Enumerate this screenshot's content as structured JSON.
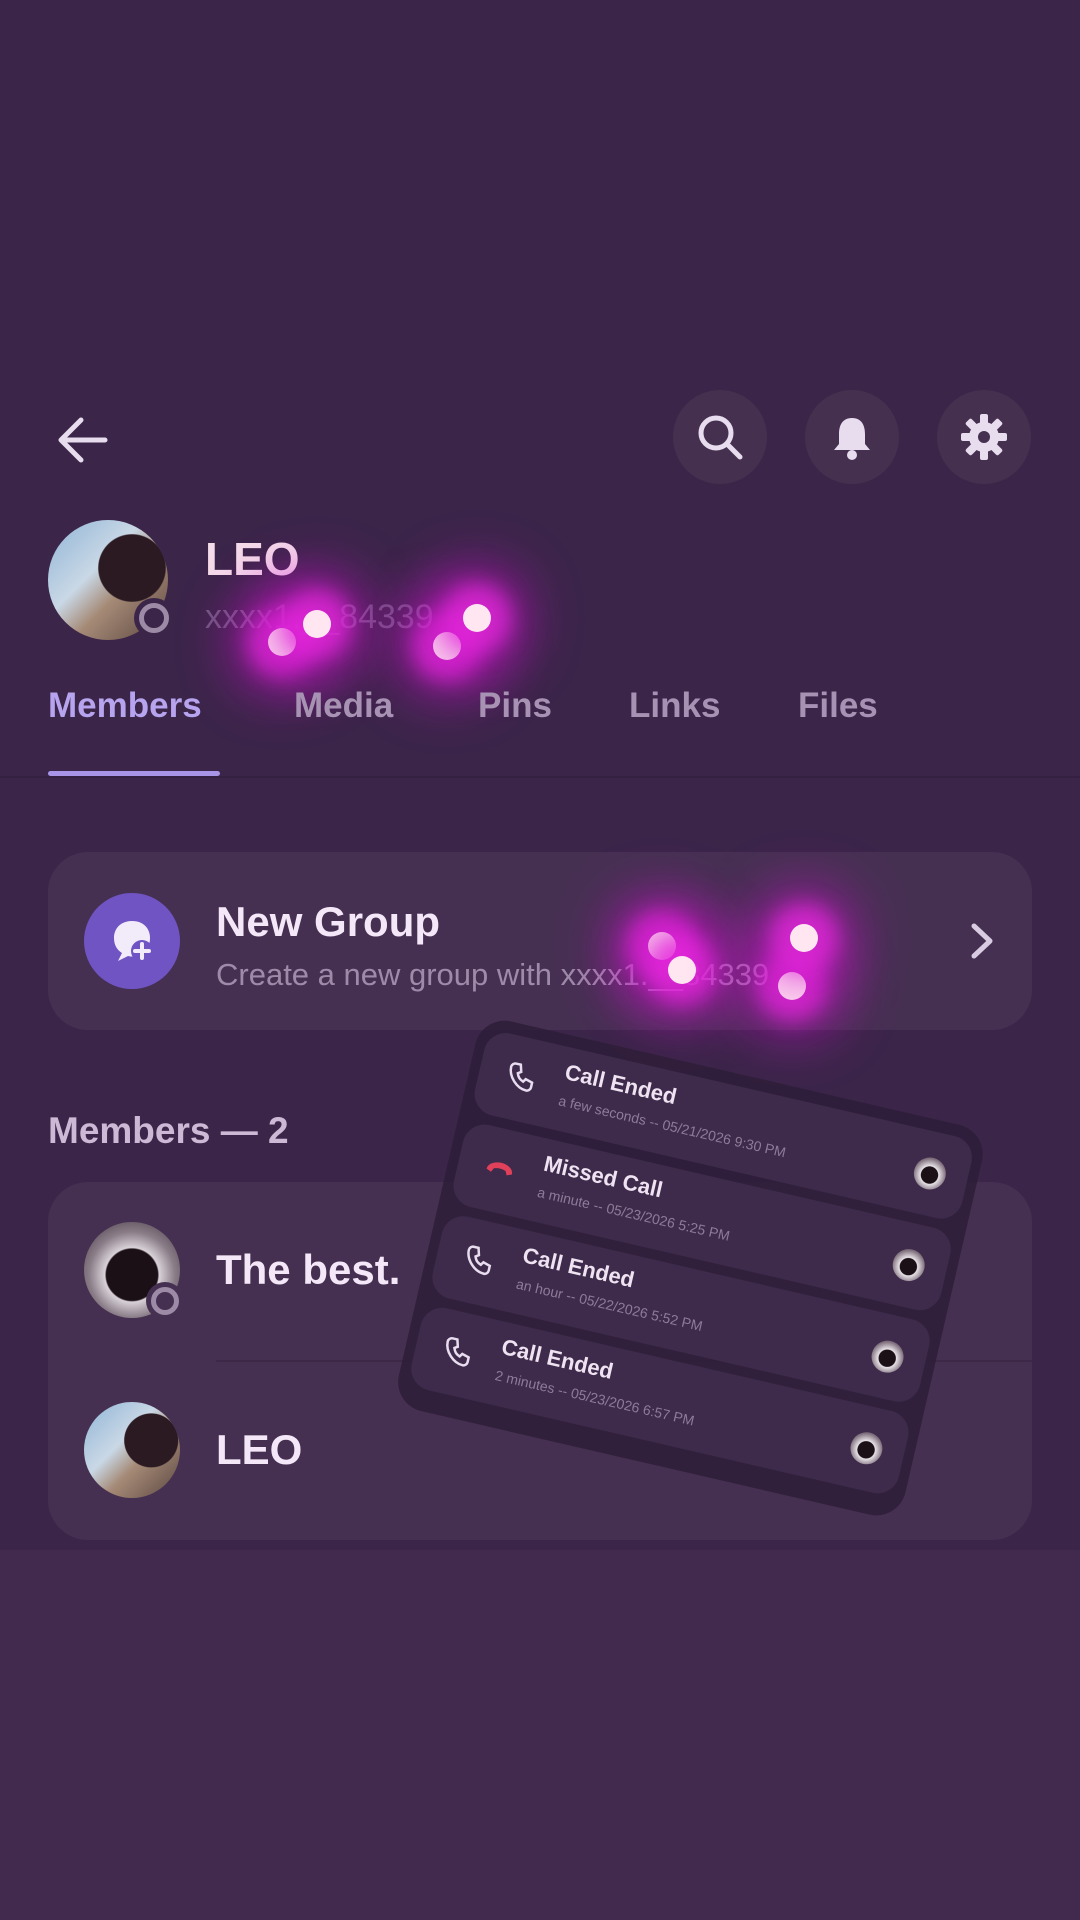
{
  "header": {
    "back_label": "back",
    "icons": [
      "search-icon",
      "bell-icon",
      "gear-icon"
    ]
  },
  "profile": {
    "name": "LEO",
    "handle": "xxxx1.__84339"
  },
  "tabs": [
    {
      "label": "Members",
      "active": true
    },
    {
      "label": "Media",
      "active": false
    },
    {
      "label": "Pins",
      "active": false
    },
    {
      "label": "Links",
      "active": false
    },
    {
      "label": "Files",
      "active": false
    }
  ],
  "new_group": {
    "title": "New Group",
    "subtitle": "Create a new group with xxxx1.__84339"
  },
  "members": {
    "header": "Members — 2",
    "items": [
      {
        "name": "The best."
      },
      {
        "name": "LEO"
      }
    ]
  },
  "calls": [
    {
      "title": "Call Ended",
      "sub": "a few seconds -- 05/21/2026 9:30 PM",
      "type": "ended"
    },
    {
      "title": "Missed Call",
      "sub": "a minute -- 05/23/2026 5:25 PM",
      "type": "missed"
    },
    {
      "title": "Call Ended",
      "sub": "an hour -- 05/22/2026 5:52 PM",
      "type": "ended"
    },
    {
      "title": "Call Ended",
      "sub": "2 minutes -- 05/23/2026 6:57 PM",
      "type": "ended"
    }
  ],
  "colors": {
    "background": "#3b2549",
    "accent": "#b7a4ef",
    "card": "#463052",
    "missed": "#e0405a"
  }
}
